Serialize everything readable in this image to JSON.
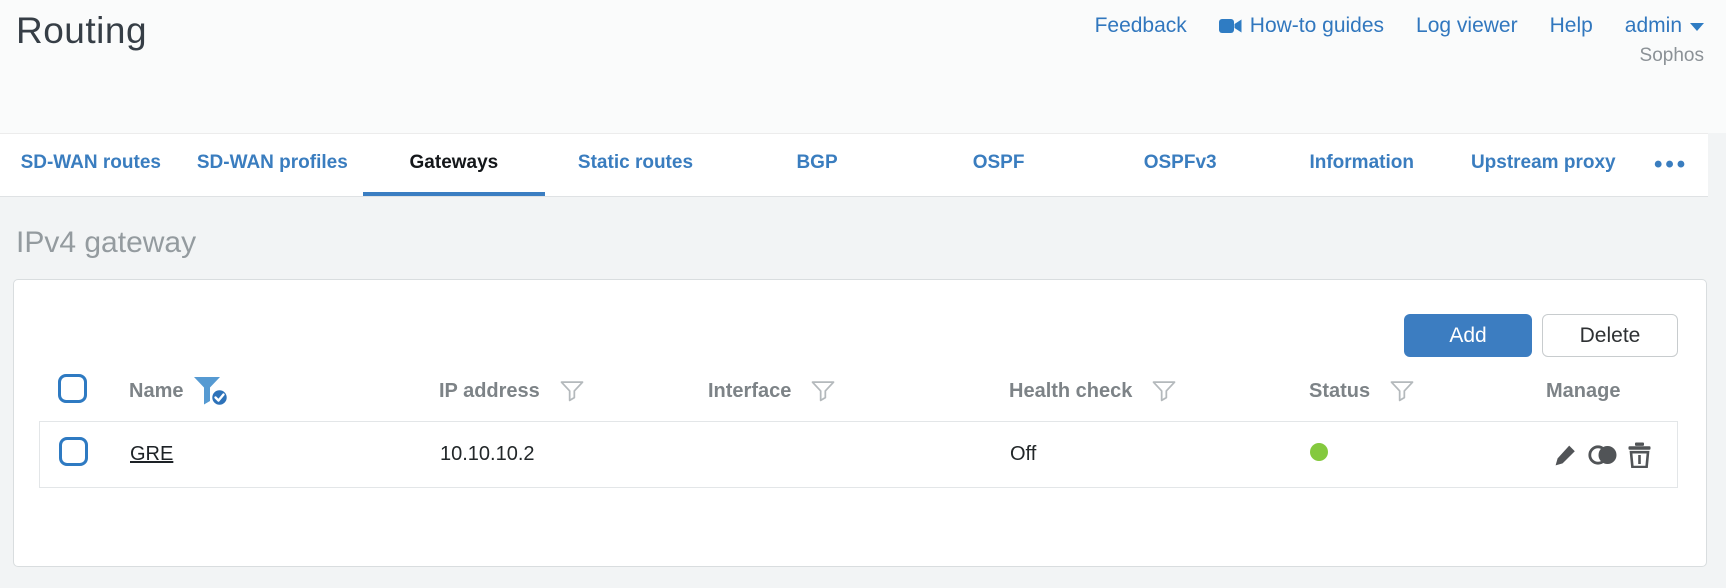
{
  "page": {
    "title": "Routing",
    "brand": "Sophos"
  },
  "header": {
    "links": [
      {
        "label": "Feedback"
      },
      {
        "label": "How-to guides",
        "icon": "video-camera-icon"
      },
      {
        "label": "Log viewer"
      },
      {
        "label": "Help"
      },
      {
        "label": "admin",
        "icon": "caret-down-icon"
      }
    ]
  },
  "tabs": {
    "items": [
      {
        "label": "SD-WAN routes",
        "active": false
      },
      {
        "label": "SD-WAN profiles",
        "active": false
      },
      {
        "label": "Gateways",
        "active": true
      },
      {
        "label": "Static routes",
        "active": false
      },
      {
        "label": "BGP",
        "active": false
      },
      {
        "label": "OSPF",
        "active": false
      },
      {
        "label": "OSPFv3",
        "active": false
      },
      {
        "label": "Information",
        "active": false
      },
      {
        "label": "Upstream proxy",
        "active": false
      }
    ],
    "more_label": "•••"
  },
  "section": {
    "title": "IPv4 gateway"
  },
  "toolbar": {
    "add_label": "Add",
    "delete_label": "Delete"
  },
  "table": {
    "columns": [
      {
        "label": "Name",
        "filter": "filter-active-icon"
      },
      {
        "label": "IP address",
        "filter": "filter-icon"
      },
      {
        "label": "Interface",
        "filter": "filter-icon"
      },
      {
        "label": "Health check",
        "filter": "filter-icon"
      },
      {
        "label": "Status",
        "filter": "filter-icon"
      },
      {
        "label": "Manage",
        "filter": null
      }
    ],
    "rows": [
      {
        "name": "GRE",
        "ip_address": "10.10.10.2",
        "interface": "",
        "health_check": "Off",
        "status": "green",
        "manage_icons": [
          "edit-icon",
          "clone-icon",
          "delete-icon"
        ]
      }
    ]
  },
  "colors": {
    "accent_blue": "#3a7dbf",
    "add_button_bg": "#3c7dc1",
    "status_green": "#84c93e"
  }
}
